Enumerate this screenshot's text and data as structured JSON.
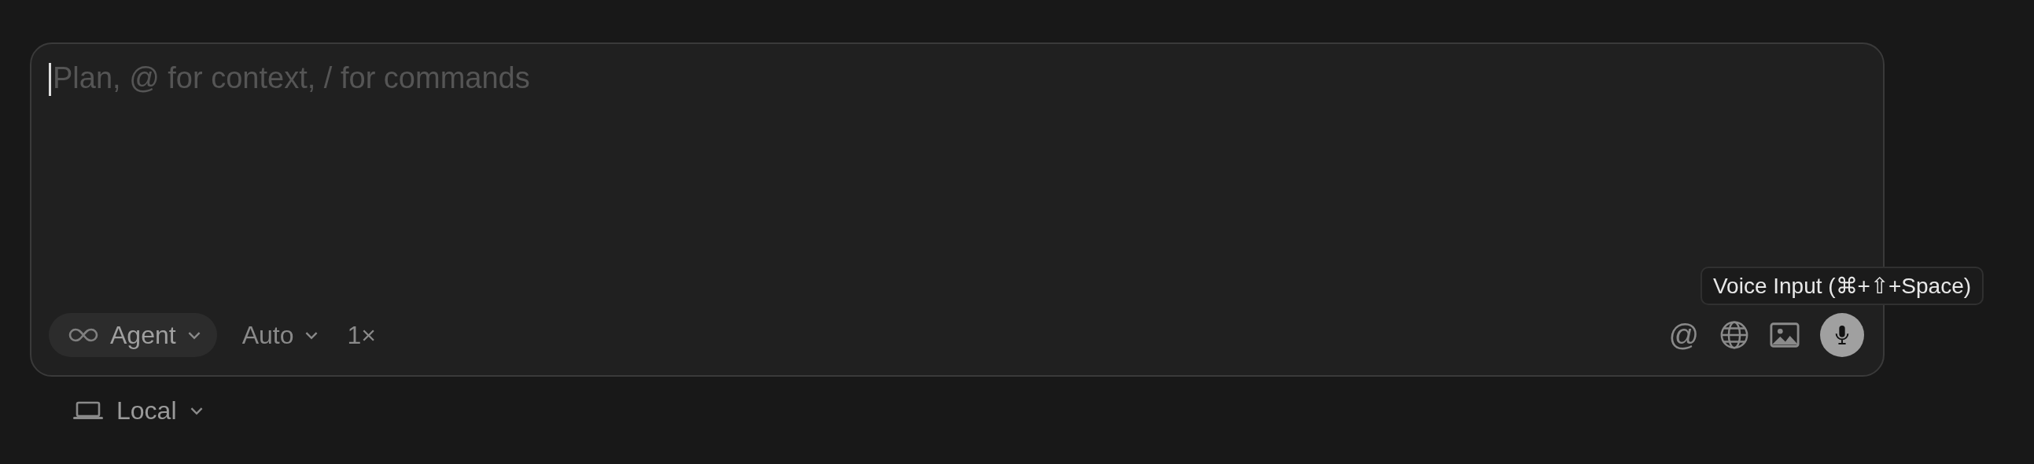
{
  "composer": {
    "placeholder": "Plan, @ for context, / for commands",
    "mode": {
      "label": "Agent",
      "selected": true
    },
    "model": {
      "label": "Auto"
    },
    "multiplier": "1×",
    "mention": "@",
    "voice": {
      "active": true,
      "tooltip": "Voice Input (⌘+⇧+Space)"
    }
  },
  "environment": {
    "label": "Local"
  }
}
